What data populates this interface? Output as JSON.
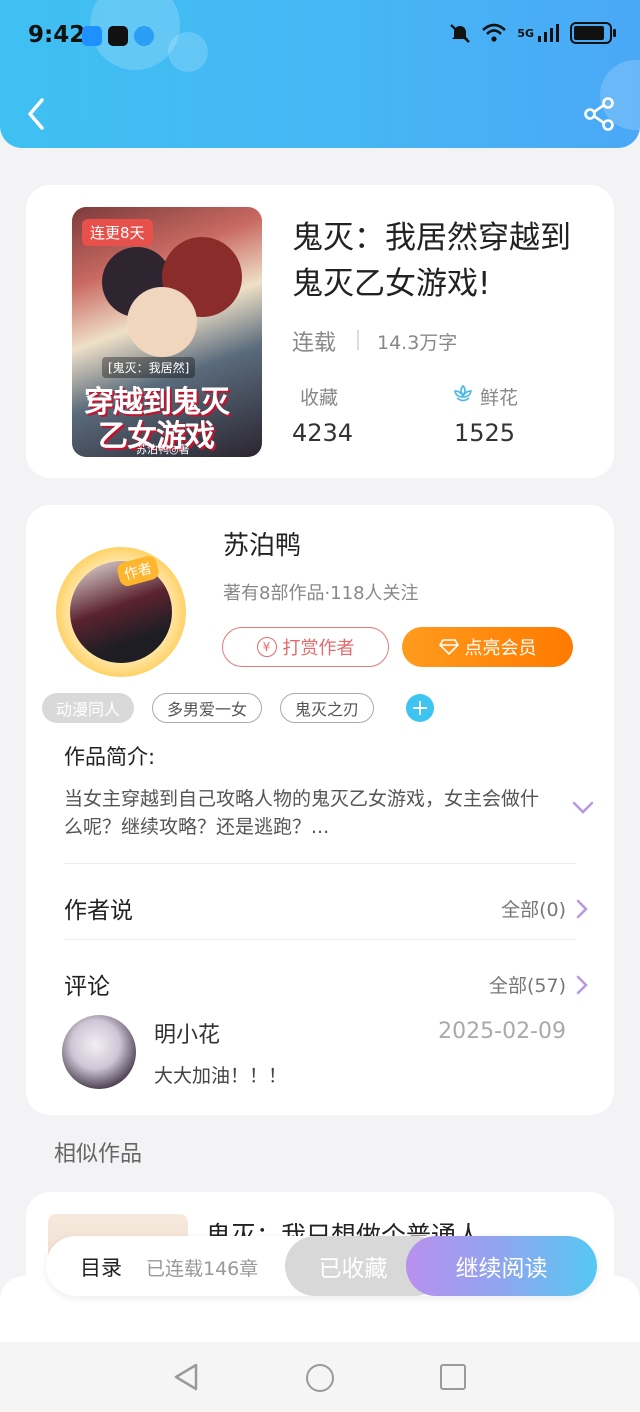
{
  "status_bar": {
    "time": "9:42",
    "network": "5G"
  },
  "nav": {
    "back": "back",
    "share": "share"
  },
  "book": {
    "cover_tag": "连更8天",
    "cover_line1": "[鬼灭：我居然]",
    "cover_line2": "穿越到鬼灭",
    "cover_line3": "乙女游戏",
    "cover_author": "苏泊鸭◎著",
    "title": "鬼灭：我居然穿越到鬼灭乙女游戏!",
    "status": "连载",
    "words": "14.3万字",
    "favorites_label": "收藏",
    "favorites_value": "4234",
    "flowers_label": "鲜花",
    "flowers_value": "1525"
  },
  "author": {
    "badge": "作者",
    "name": "苏泊鸭",
    "meta": "著有8部作品·118人关注",
    "tip_button": "打赏作者",
    "vip_button": "点亮会员"
  },
  "tags": [
    "动漫同人",
    "多男爱一女",
    "鬼灭之刃"
  ],
  "intro": {
    "title": "作品简介:",
    "text": "当女主穿越到自己攻略人物的鬼灭乙女游戏，女主会做什么呢？继续攻略？还是逃跑？..."
  },
  "author_says": {
    "title": "作者说",
    "link": "全部(0)"
  },
  "comments": {
    "title": "评论",
    "link": "全部(57)",
    "items": [
      {
        "name": "明小花",
        "date": "2025-02-09",
        "text": "大大加油！！！"
      }
    ]
  },
  "similar": {
    "title": "相似作品",
    "items": [
      {
        "title": "鬼灭：我只想做个普通人"
      }
    ]
  },
  "bottom_bar": {
    "toc": "目录",
    "chapters": "已连载146章",
    "favorited": "已收藏",
    "continue": "继续阅读"
  },
  "colors": {
    "header": "#46b6f4",
    "accent_orange": "#ff8a00",
    "tip_red": "#e36a6c",
    "plus_blue": "#3ec4f0"
  }
}
